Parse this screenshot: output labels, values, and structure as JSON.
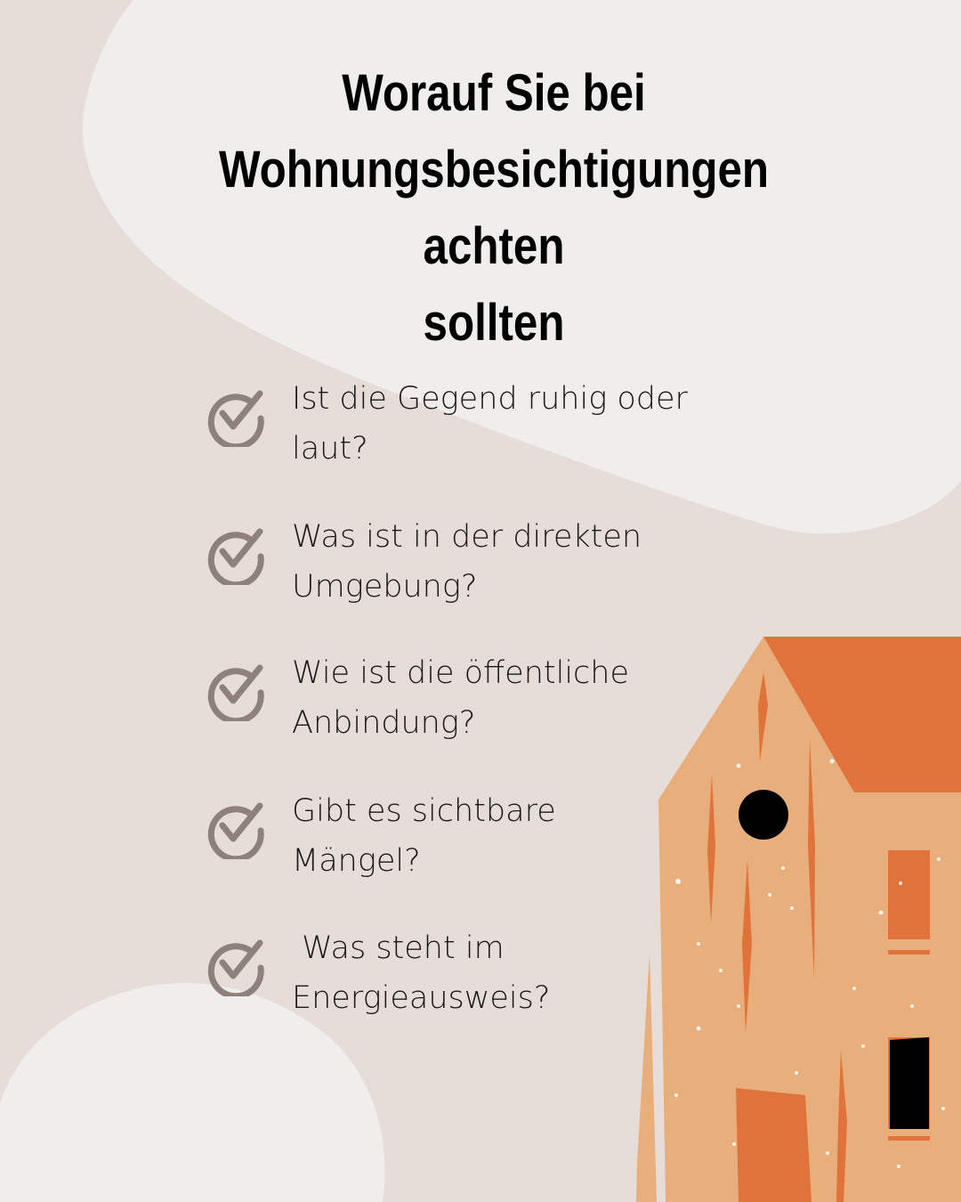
{
  "title": {
    "line1": "Worauf Sie bei",
    "line2": "Wohnungsbesichtigungen achten",
    "line3": "sollten"
  },
  "checklist": [
    {
      "line1": "Ist die Gegend ruhig oder",
      "line2": "laut?"
    },
    {
      "line1": "Was ist in der direkten",
      "line2": "Umgebung?"
    },
    {
      "line1": "Wie ist die öffentliche",
      "line2": "Anbindung?"
    },
    {
      "line1": "Gibt es sichtbare",
      "line2": "Mängel?"
    },
    {
      "line1": " Was steht im",
      "line2": "Energieausweis?"
    }
  ],
  "icons": {
    "check": "check-circle-icon",
    "house": "house-illustration"
  },
  "colors": {
    "background": "#e7ddd8",
    "blob": "#f0eeec",
    "check": "#8e807b",
    "house_wall": "#e8ae7b",
    "house_roof": "#df733b",
    "house_window": "#df733b"
  }
}
